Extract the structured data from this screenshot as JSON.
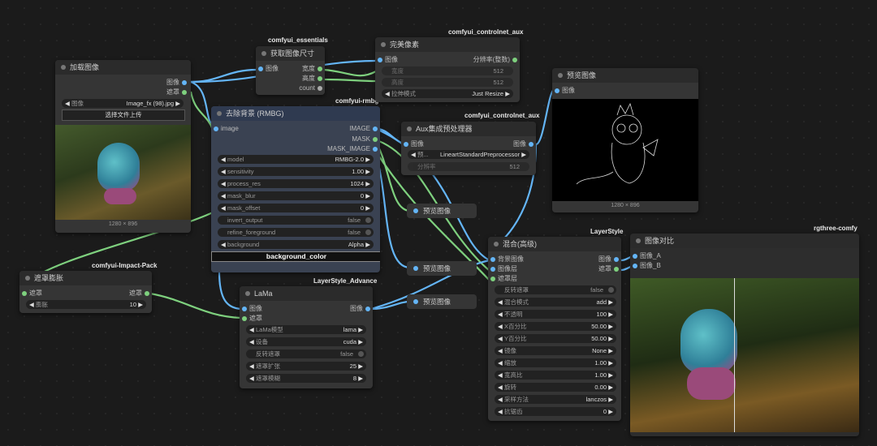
{
  "labels": {
    "essentials": "comfyui_essentials",
    "aux1": "comfyui_controlnet_aux",
    "rmbg_tag": "comfyui-rmbg",
    "aux2": "comfyui_controlnet_aux",
    "impact": "comfyui-Impact-Pack",
    "lsadv": "LayerStyle_Advance",
    "ls": "LayerStyle",
    "rgthree": "rgthree-comfy"
  },
  "load": {
    "title": "加载图像",
    "out_image": "图像",
    "out_mask": "遮罩",
    "image_file": "Image_fx (98).jpg",
    "image_label": "图像",
    "upload": "选择文件上传",
    "size": "1280 × 896"
  },
  "getsize": {
    "title": "获取图像尺寸",
    "in_image": "图像",
    "out_w": "宽度",
    "out_h": "高度",
    "out_c": "count"
  },
  "perfect": {
    "title": "完美像素",
    "in_image": "图像",
    "out_res": "分辨率(整数)",
    "w_l": "宽度",
    "w_v": "512",
    "h_l": "高度",
    "h_v": "512",
    "mode_l": "拉伸模式",
    "mode_v": "Just Resize"
  },
  "rmbg": {
    "title": "去除背景 (RMBG)",
    "in_image": "image",
    "out1": "IMAGE",
    "out2": "MASK",
    "out3": "MASK_IMAGE",
    "widgets": [
      [
        "model",
        "RMBG-2.0"
      ],
      [
        "sensitivity",
        "1.00"
      ],
      [
        "process_res",
        "1024"
      ],
      [
        "mask_blur",
        "0"
      ],
      [
        "mask_offset",
        "0"
      ]
    ],
    "tog1_l": "invert_output",
    "tog1_v": "false",
    "tog2_l": "refine_foreground",
    "tog2_v": "false",
    "bg_l": "background",
    "bg_v": "Alpha",
    "bgc": "background_color"
  },
  "auxpre": {
    "title": "Aux集成预处理器",
    "in_image": "图像",
    "out_image": "图像",
    "pre_l": "预...",
    "pre_v": "LineartStandardPreprocessor",
    "res_l": "分辨率",
    "res_v": "512"
  },
  "preview1": {
    "title": "预览图像",
    "in_image": "图像",
    "size": "1280 × 896"
  },
  "pv_a": "预览图像",
  "pv_b": "预览图像",
  "pv_c": "预览图像",
  "maskgrow": {
    "title": "遮罩膨胀",
    "in_mask": "遮罩",
    "out_mask": "遮罩",
    "exp_l": "膨胀",
    "exp_v": "10"
  },
  "lama": {
    "title": "LaMa",
    "in_image": "图像",
    "in_mask": "遮罩",
    "out_image": "图像",
    "m_l": "LaMa模型",
    "m_v": "lama",
    "d_l": "设备",
    "d_v": "cuda",
    "inv_l": "反转遮罩",
    "inv_v": "false",
    "g_l": "遮罩扩张",
    "g_v": "25",
    "b_l": "遮罩模糊",
    "b_v": "8"
  },
  "blend": {
    "title": "混合(高级)",
    "in1": "背景图像",
    "in2": "图像层",
    "in3": "遮罩层",
    "out_image": "图像",
    "out_mask": "遮罩",
    "inv_l": "反转遮罩",
    "inv_v": "false",
    "widgets": [
      [
        "混合模式",
        "add"
      ],
      [
        "不透明",
        "100"
      ],
      [
        "X百分比",
        "50.00"
      ],
      [
        "Y百分比",
        "50.00"
      ],
      [
        "镜像",
        "None"
      ],
      [
        "缩放",
        "1.00"
      ],
      [
        "宽高比",
        "1.00"
      ],
      [
        "旋转",
        "0.00"
      ],
      [
        "采样方法",
        "lanczos"
      ],
      [
        "抗锯齿",
        "0"
      ]
    ]
  },
  "compare": {
    "title": "图像对比",
    "in_a": "图像_A",
    "in_b": "图像_B"
  },
  "colors": {
    "blue_wire": "#64b5f6",
    "green_wire": "#7ed07e"
  }
}
